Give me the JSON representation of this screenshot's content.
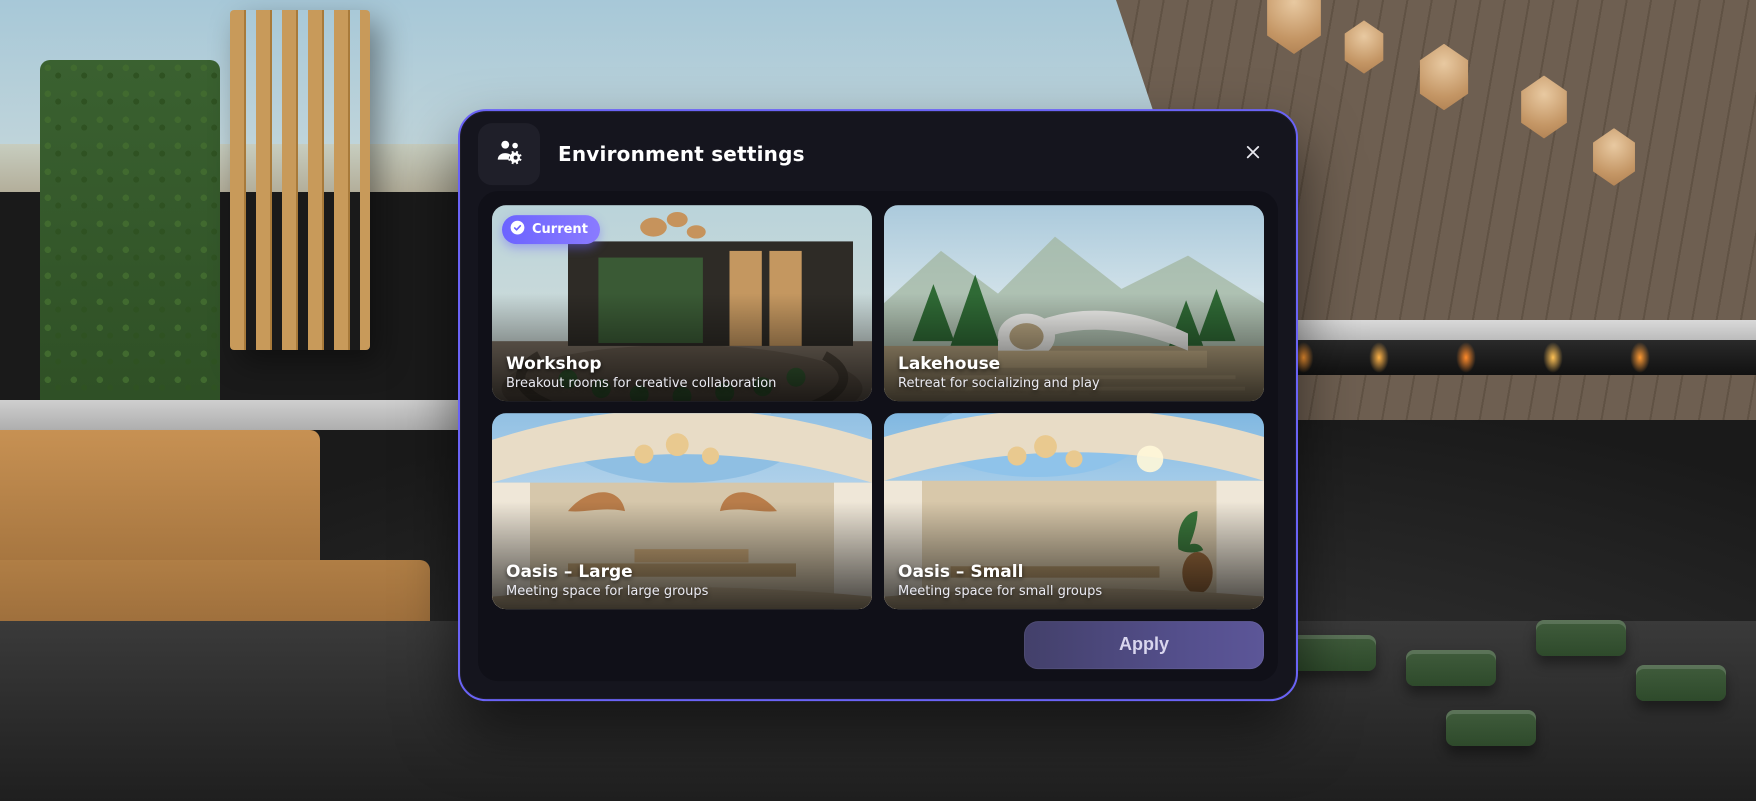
{
  "dialog": {
    "title": "Environment settings",
    "apply_label": "Apply",
    "current_badge_label": "Current"
  },
  "environments": [
    {
      "id": "workshop",
      "name": "Workshop",
      "desc": "Breakout rooms for creative collaboration",
      "current": true
    },
    {
      "id": "lakehouse",
      "name": "Lakehouse",
      "desc": "Retreat for socializing and play",
      "current": false
    },
    {
      "id": "oasis-large",
      "name": "Oasis – Large",
      "desc": "Meeting space for large groups",
      "current": false
    },
    {
      "id": "oasis-small",
      "name": "Oasis – Small",
      "desc": "Meeting space for small groups",
      "current": false
    }
  ]
}
